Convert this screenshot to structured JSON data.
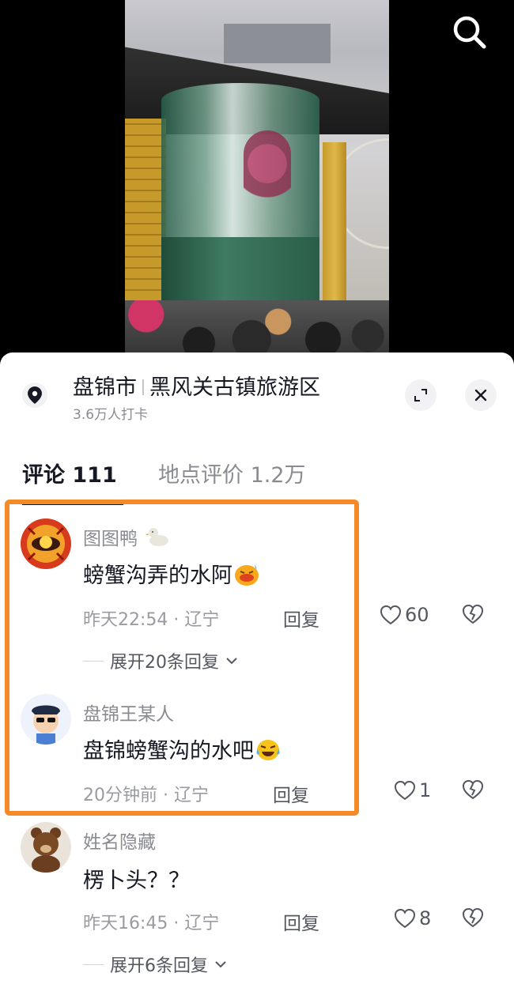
{
  "location": {
    "city": "盘锦市",
    "place": "黑风关古镇旅游区",
    "checkins": "3.6万人打卡"
  },
  "tabs": {
    "comments_label": "评论 111",
    "reviews_label": "地点评价 1.2万"
  },
  "comments": [
    {
      "user": "图图鸭",
      "text": "螃蟹沟弄的水阿",
      "time_place": "昨天22:54 · 辽宁",
      "reply": "回复",
      "likes": "60",
      "expand": "展开20条回复"
    },
    {
      "user": "盘锦王某人",
      "text": "盘锦螃蟹沟的水吧",
      "time_place": "20分钟前 · 辽宁",
      "reply": "回复",
      "likes": "1"
    },
    {
      "user": "姓名隐藏",
      "text": "楞卜头？？",
      "time_place": "昨天16:45 · 辽宁",
      "reply": "回复",
      "likes": "8",
      "expand": "展开6条回复"
    }
  ],
  "colors": {
    "highlight": "#f58a28",
    "text_primary": "#161823",
    "text_secondary": "#8a8b91"
  }
}
